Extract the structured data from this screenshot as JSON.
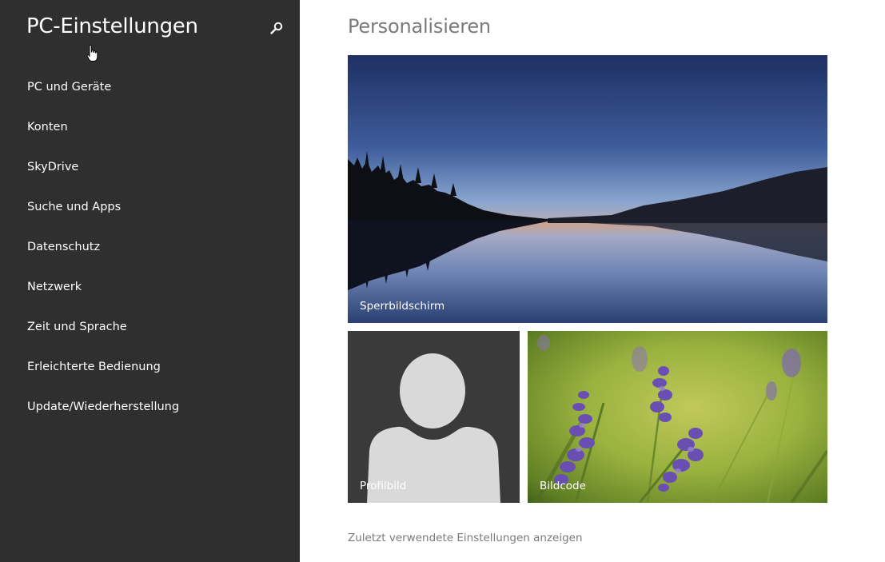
{
  "sidebar": {
    "title": "PC-Einstellungen",
    "search_icon": "search-icon",
    "items": [
      {
        "label": "PC und Geräte"
      },
      {
        "label": "Konten"
      },
      {
        "label": "SkyDrive"
      },
      {
        "label": "Suche und Apps"
      },
      {
        "label": "Datenschutz"
      },
      {
        "label": "Netzwerk"
      },
      {
        "label": "Zeit und Sprache"
      },
      {
        "label": "Erleichterte Bedienung"
      },
      {
        "label": "Update/Wiederherstellung"
      }
    ]
  },
  "main": {
    "title": "Personalisieren",
    "tiles": {
      "lock_screen": {
        "label": "Sperrbildschirm"
      },
      "account_picture": {
        "label": "Profilbild"
      },
      "picture_password": {
        "label": "Bildcode"
      }
    },
    "recent_link": "Zuletzt verwendete Einstellungen anzeigen"
  },
  "colors": {
    "sidebar_bg": "#2f2f2f",
    "title_gray": "#7a7a7a",
    "profile_tile_bg": "#3a3a3a"
  }
}
